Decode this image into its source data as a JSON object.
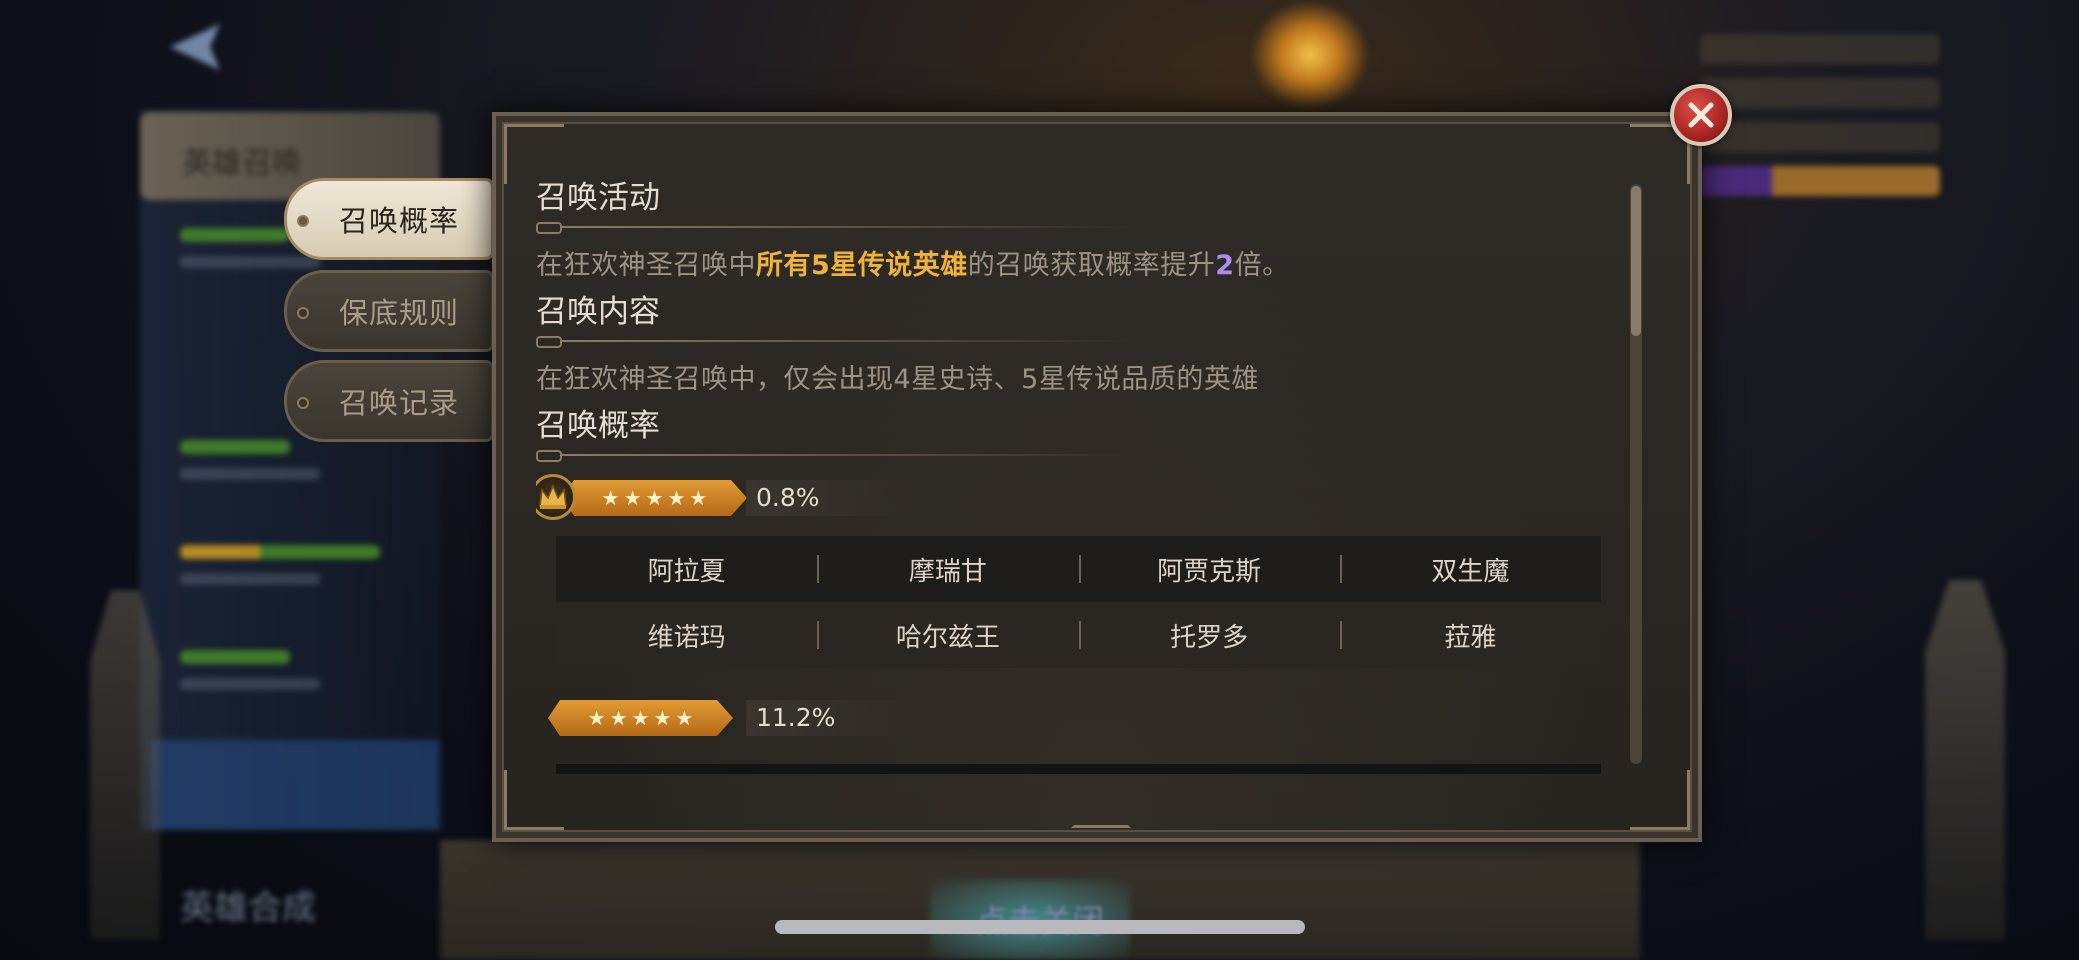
{
  "side_tabs": [
    {
      "label": "召唤概率",
      "active": true
    },
    {
      "label": "保底规则",
      "active": false
    },
    {
      "label": "召唤记录",
      "active": false
    }
  ],
  "sections": {
    "activity": {
      "title": "召唤活动",
      "text_before": "在狂欢神圣召唤中",
      "highlight": "所有5星传说英雄",
      "text_middle": "的召唤获取概率提升",
      "multiplier": "2",
      "text_after": "倍。"
    },
    "content": {
      "title": "召唤内容",
      "text": "在狂欢神圣召唤中，仅会出现4星史诗、5星传说品质的英雄"
    },
    "probability": {
      "title": "召唤概率",
      "tiers": [
        {
          "stars": 5,
          "crown": true,
          "rate": "0.8%"
        },
        {
          "stars": 5,
          "crown": false,
          "rate": "11.2%"
        }
      ],
      "legend_heroes": [
        [
          "阿拉夏",
          "摩瑞甘",
          "阿贾克斯",
          "双生魔"
        ],
        [
          "维诺玛",
          "哈尔兹王",
          "托罗多",
          "菈雅"
        ]
      ]
    }
  },
  "background": {
    "bottom_hint": "点击关闭",
    "left_bottom_label": "英雄合成",
    "left_top_tab": "英雄召唤"
  },
  "colors": {
    "highlight_gold": "#f0b23a",
    "highlight_purple": "#a98ef0",
    "ribbon_orange": "#e29b33",
    "close_red": "#c0302c"
  },
  "icons": {
    "close": "close-icon",
    "crown": "crown-icon",
    "star": "star-icon",
    "back": "back-arrow-icon"
  }
}
